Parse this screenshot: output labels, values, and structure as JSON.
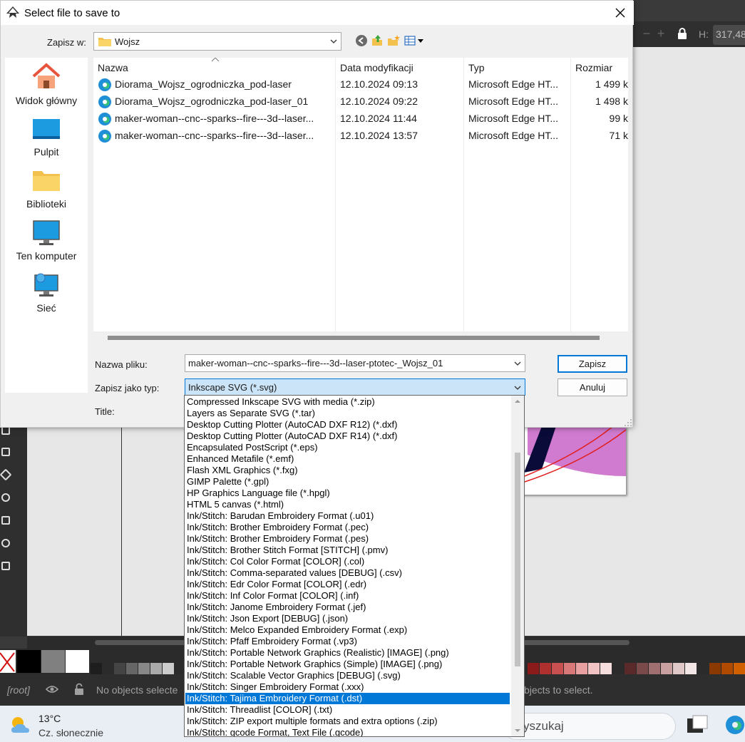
{
  "dialog": {
    "title": "Select file to save to",
    "save_in_label": "Zapisz w:",
    "current_folder": "Wojsz",
    "filename_label": "Nazwa pliku:",
    "filename_value": "maker-woman--cnc--sparks--fire---3d--laser-ptotec-_Wojsz_01",
    "filetype_label": "Zapisz jako typ:",
    "filetype_value": "Inkscape SVG (*.svg)",
    "title_label": "Title:",
    "save_button": "Zapisz",
    "cancel_button": "Anuluj"
  },
  "places": [
    {
      "label": "Widok główny",
      "icon": "home-icon"
    },
    {
      "label": "Pulpit",
      "icon": "desktop-icon"
    },
    {
      "label": "Biblioteki",
      "icon": "libraries-folder-icon"
    },
    {
      "label": "Ten komputer",
      "icon": "computer-icon"
    },
    {
      "label": "Sieć",
      "icon": "network-icon"
    }
  ],
  "file_list": {
    "columns": [
      "Nazwa",
      "Data modyfikacji",
      "Typ",
      "Rozmiar"
    ],
    "rows": [
      {
        "name": "Diorama_Wojsz_ogrodniczka_pod-laser",
        "date": "12.10.2024 09:13",
        "type": "Microsoft Edge HT...",
        "size": "1 499 k"
      },
      {
        "name": "Diorama_Wojsz_ogrodniczka_pod-laser_01",
        "date": "12.10.2024 09:22",
        "type": "Microsoft Edge HT...",
        "size": "1 498 k"
      },
      {
        "name": "maker-woman--cnc--sparks--fire---3d--laser...",
        "date": "12.10.2024 11:44",
        "type": "Microsoft Edge HT...",
        "size": "99 k"
      },
      {
        "name": "maker-woman--cnc--sparks--fire---3d--laser...",
        "date": "12.10.2024 13:57",
        "type": "Microsoft Edge HT...",
        "size": "71 k"
      }
    ]
  },
  "filetype_options": [
    "Compressed Inkscape SVG with media (*.zip)",
    "Layers as Separate SVG (*.tar)",
    "Desktop Cutting Plotter (AutoCAD DXF R12) (*.dxf)",
    "Desktop Cutting Plotter (AutoCAD DXF R14) (*.dxf)",
    "Encapsulated PostScript (*.eps)",
    "Enhanced Metafile (*.emf)",
    "Flash XML Graphics (*.fxg)",
    "GIMP Palette (*.gpl)",
    "HP Graphics Language file (*.hpgl)",
    "HTML 5 canvas (*.html)",
    "Ink/Stitch: Barudan Embroidery Format (.u01)",
    "Ink/Stitch: Brother Embroidery Format (.pec)",
    "Ink/Stitch: Brother Embroidery Format (.pes)",
    "Ink/Stitch: Brother Stitch Format [STITCH] (.pmv)",
    "Ink/Stitch: Col Color Format [COLOR] (.col)",
    "Ink/Stitch: Comma-separated values [DEBUG] (.csv)",
    "Ink/Stitch: Edr Color Format [COLOR] (.edr)",
    "Ink/Stitch: Inf Color Format [COLOR] (.inf)",
    "Ink/Stitch: Janome Embroidery Format (.jef)",
    "Ink/Stitch: Json Export [DEBUG] (.json)",
    "Ink/Stitch: Melco Expanded Embroidery Format (.exp)",
    "Ink/Stitch: Pfaff Embroidery Format (.vp3)",
    "Ink/Stitch: Portable Network Graphics (Realistic) [IMAGE] (.png)",
    "Ink/Stitch: Portable Network Graphics (Simple) [IMAGE] (.png)",
    "Ink/Stitch: Scalable Vector Graphics [DEBUG] (.svg)",
    "Ink/Stitch: Singer Embroidery Format (.xxx)",
    "Ink/Stitch: Tajima Embroidery Format (.dst)",
    "Ink/Stitch: Threadlist [COLOR] (.txt)",
    "Ink/Stitch: ZIP export multiple formats and extra options (.zip)",
    "Ink/Stitch: gcode Format, Text File (.gcode)"
  ],
  "selected_option_index": 26,
  "background": {
    "h_label": "H:",
    "h_value": "317,48",
    "layer_root": "[root]",
    "status_left": "No objects selecte",
    "status_right": "bjects to select."
  },
  "taskbar": {
    "temperature": "13°C",
    "condition": "Cz. słonecznie",
    "search_text": "yszukaj"
  },
  "colors": {
    "accent": "#0078d7",
    "selection": "#0078d7",
    "inkscape_bg": "#3a3a3a"
  }
}
